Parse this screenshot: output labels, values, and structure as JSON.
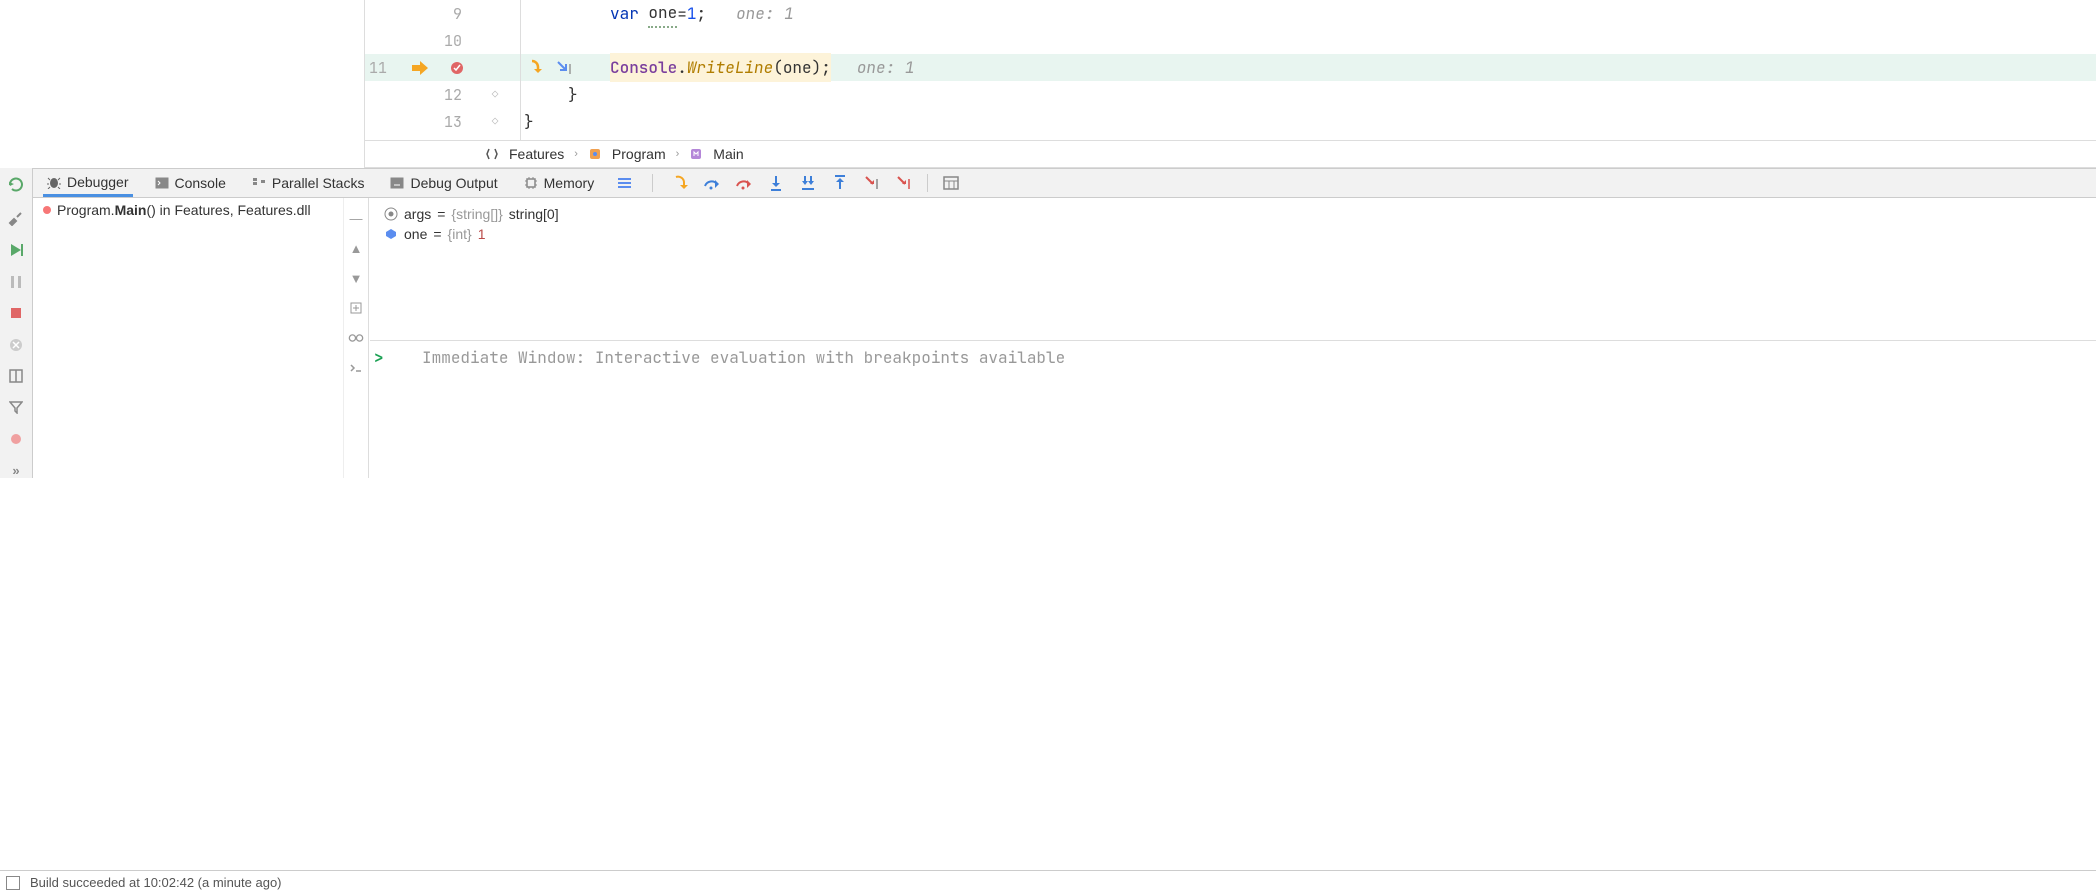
{
  "editor": {
    "lines": {
      "9": {
        "num": "9",
        "kw": "var",
        "ident": "one",
        "eq": " = ",
        "val": "1",
        "semi": ";",
        "hint": "one: 1"
      },
      "10": {
        "num": "10"
      },
      "11": {
        "num": "11",
        "obj": "Console",
        "dot": ".",
        "call": "WriteLine",
        "args": "(one);",
        "hint": "one: 1"
      },
      "12": {
        "num": "12",
        "brace": "}"
      },
      "13": {
        "num": "13",
        "brace": "}"
      }
    }
  },
  "breadcrumb": {
    "a": "Features",
    "b": "Program",
    "c": "Main"
  },
  "tabs": {
    "debugger": "Debugger",
    "console": "Console",
    "parallel": "Parallel Stacks",
    "output": "Debug Output",
    "memory": "Memory"
  },
  "frame": {
    "prefix": "Program.",
    "method": "Main",
    "suffix": "() in Features, Features.dll"
  },
  "vars": {
    "args": {
      "name": "args",
      "eq": " = ",
      "type": "{string[]} ",
      "value": "string[0]"
    },
    "one": {
      "name": "one",
      "eq": " = ",
      "type": "{int} ",
      "value": "1"
    }
  },
  "immediate": {
    "prompt": ">",
    "placeholder": "Immediate Window: Interactive evaluation with breakpoints available"
  },
  "status": {
    "text": "Build succeeded at 10:02:42 (a minute ago)"
  }
}
